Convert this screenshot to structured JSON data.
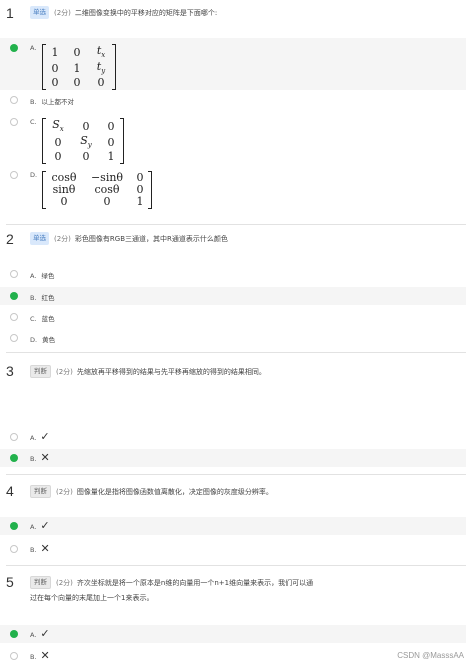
{
  "questions": [
    {
      "number": "1",
      "type": "单选",
      "score": "(2分)",
      "text": "二维图像变换中的平移对应的矩阵是下面哪个:",
      "options": [
        {
          "letter": "A.",
          "matrix": [
            "1",
            "0",
            "t_x",
            "0",
            "1",
            "t_y",
            "0",
            "0",
            "0"
          ],
          "selected": true
        },
        {
          "letter": "B.",
          "text": "以上都不对",
          "selected": false
        },
        {
          "letter": "C.",
          "matrix": [
            "S_x",
            "0",
            "0",
            "0",
            "S_y",
            "0",
            "0",
            "0",
            "1"
          ],
          "selected": false
        },
        {
          "letter": "D.",
          "matrix": [
            "cosθ",
            "−sinθ",
            "0",
            "sinθ",
            "cosθ",
            "0",
            "0",
            "0",
            "1"
          ],
          "selected": false
        }
      ]
    },
    {
      "number": "2",
      "type": "单选",
      "score": "(2分)",
      "text": "彩色图像有RGB三通道，其中R通道表示什么颜色",
      "options": [
        {
          "letter": "A.",
          "text": "绿色",
          "selected": false
        },
        {
          "letter": "B.",
          "text": "红色",
          "selected": true
        },
        {
          "letter": "C.",
          "text": "蓝色",
          "selected": false
        },
        {
          "letter": "D.",
          "text": "黄色",
          "selected": false
        }
      ]
    },
    {
      "number": "3",
      "type": "判断",
      "score": "(2分)",
      "text": "先缩放再平移得到的结果与先平移再缩放的得到的结果相同。",
      "options": [
        {
          "letter": "A.",
          "mark": "✓",
          "selected": false
        },
        {
          "letter": "B.",
          "mark": "✕",
          "selected": true
        }
      ]
    },
    {
      "number": "4",
      "type": "判断",
      "score": "(2分)",
      "text": "图像量化是指将图像函数值离散化，决定图像的灰度级分辨率。",
      "options": [
        {
          "letter": "A.",
          "mark": "✓",
          "selected": true
        },
        {
          "letter": "B.",
          "mark": "✕",
          "selected": false
        }
      ]
    },
    {
      "number": "5",
      "type": "判断",
      "score": "(2分)",
      "text": "齐次坐标就是将一个原本是n维的向量用一个n+1维向量来表示，我们可以通",
      "text2": "过在每个向量的末尾加上一个1来表示。",
      "options": [
        {
          "letter": "A.",
          "mark": "✓",
          "selected": true
        },
        {
          "letter": "B.",
          "mark": "✕",
          "selected": false
        }
      ]
    }
  ],
  "watermark": "CSDN @MasssAA",
  "colors": {
    "selected": "#22b14c",
    "tag_single": "#d9e8fb",
    "tag_judge": "#eaeaea"
  }
}
